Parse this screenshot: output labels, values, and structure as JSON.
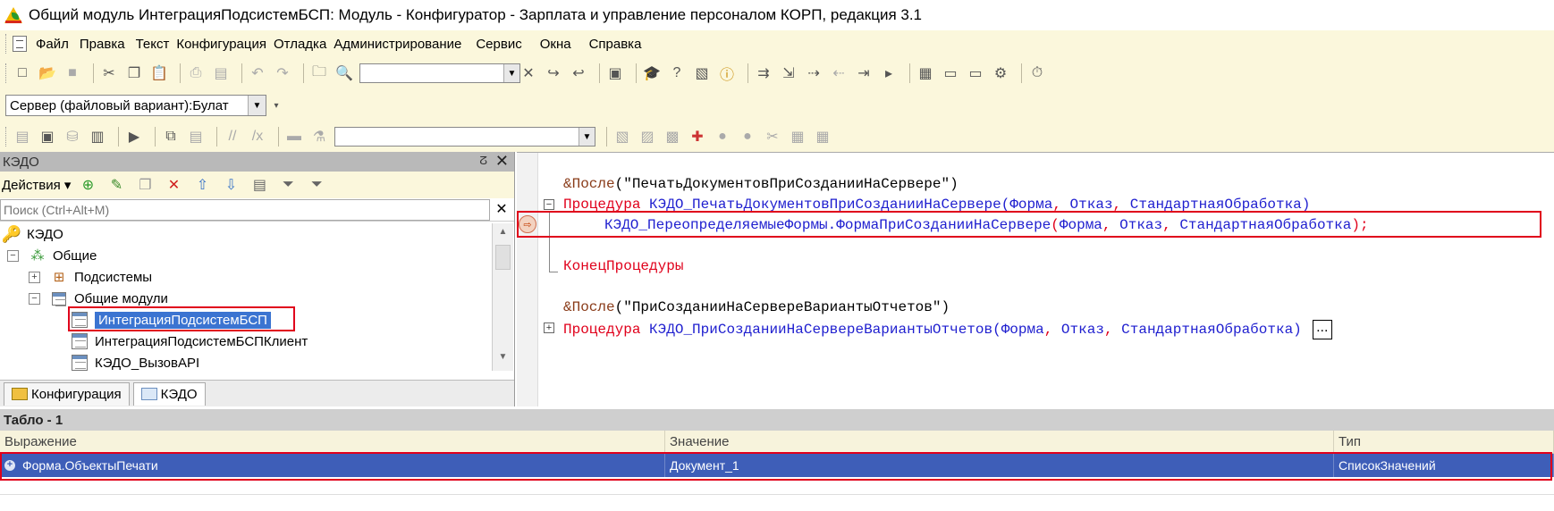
{
  "window": {
    "title": "Общий модуль ИнтеграцияПодсистемБСП: Модуль - Конфигуратор - Зарплата и управление персоналом КОРП, редакция 3.1"
  },
  "menu": [
    "Файл",
    "Правка",
    "Текст",
    "Конфигурация",
    "Отладка",
    "Администрирование",
    "Сервис",
    "Окна",
    "Справка"
  ],
  "toolbar": {
    "server_combo": "Сервер (файловый вариант):Булат"
  },
  "left_panel": {
    "title": "КЭДО",
    "actions_label": "Действия ▾",
    "search_placeholder": "Поиск (Ctrl+Alt+M)",
    "tree": {
      "root": "КЭДО",
      "common": "Общие",
      "subsystems": "Подсистемы",
      "common_modules": "Общие модули",
      "module_1": "ИнтеграцияПодсистемБСП",
      "module_2": "ИнтеграцияПодсистемБСПКлиент",
      "module_3": "КЭДО_ВызовAPI"
    },
    "tabs": [
      "Конфигурация",
      "КЭДО"
    ]
  },
  "editor": {
    "line1": {
      "prefix": "&После",
      "args": "(\"ПечатьДокументовПриСозданииНаСервере\")"
    },
    "line2": {
      "kw": "Процедура",
      "name": "КЭДО_ПечатьДокументовПриСозданииНаСервере",
      "open": "(",
      "p1": "Форма",
      "sep1": ", ",
      "p2": "Отказ",
      "sep2": ", ",
      "p3": "СтандартнаяОбработка",
      "close": ")"
    },
    "line3": {
      "call": "КЭДО_ПереопределяемыеФормы.ФормаПриСозданииНаСервере",
      "open": "(",
      "p1": "Форма",
      "sep1": ", ",
      "p2": "Отказ",
      "sep2": ", ",
      "p3": "СтандартнаяОбработка",
      "close": ");"
    },
    "line4": {
      "kw": "КонецПроцедуры"
    },
    "line5": {
      "prefix": "&После",
      "args": "(\"ПриСозданииНаСервереВариантыОтчетов\")"
    },
    "line6": {
      "kw": "Процедура",
      "name": "КЭДО_ПриСозданииНаСервереВариантыОтчетов",
      "open": "(",
      "p1": "Форма",
      "sep1": ", ",
      "p2": "Отказ",
      "sep2": ", ",
      "p3": "СтандартнаяОбработка",
      "close": ")",
      "ellipsis": "..."
    }
  },
  "tablo": {
    "title": "Табло - 1",
    "columns": [
      "Выражение",
      "Значение",
      "Тип"
    ],
    "rows": [
      {
        "expression": "Форма.ОбъектыПечати",
        "value": "Документ_1",
        "type": "СписокЗначений"
      }
    ]
  },
  "colors": {
    "keyword": "#e0001b",
    "identifier": "#1e1ecf",
    "selection": "#3e5eb8",
    "highlight_box": "#e0001b"
  }
}
